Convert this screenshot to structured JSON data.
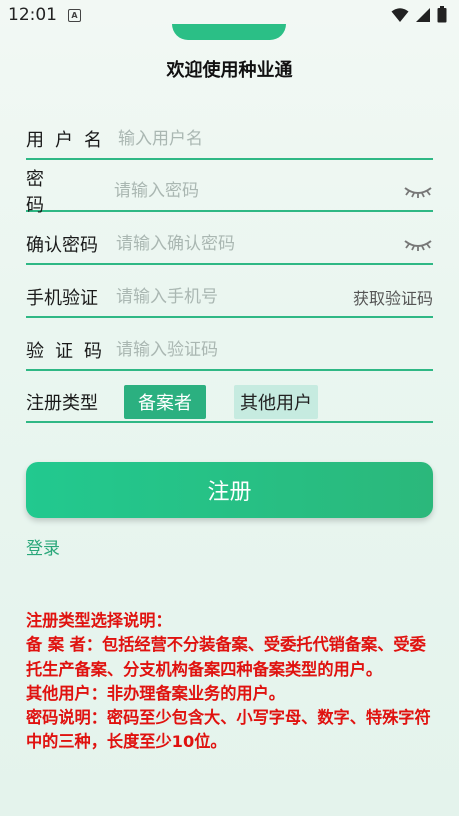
{
  "status_bar": {
    "time": "12:01",
    "notification_icon": "A"
  },
  "page_title": "欢迎使用种业通",
  "form": {
    "username": {
      "label": "用户名",
      "placeholder": "输入用户名"
    },
    "password": {
      "label": "密码",
      "placeholder": "请输入密码"
    },
    "confirm_password": {
      "label": "确认密码",
      "placeholder": "请输入确认密码"
    },
    "phone": {
      "label": "手机验证",
      "placeholder": "请输入手机号",
      "get_code_label": "获取验证码"
    },
    "code": {
      "label": "验证码",
      "placeholder": "请输入验证码"
    },
    "reg_type": {
      "label": "注册类型",
      "options": [
        "备案者",
        "其他用户"
      ],
      "selected": "备案者"
    }
  },
  "register_button": "注册",
  "login_link": "登录",
  "notes": {
    "heading": "注册类型选择说明：",
    "filer": "备 案 者：包括经营不分装备案、受委托代销备案、受委托生产备案、分支机构备案四种备案类型的用户。",
    "other": "其他用户：非办理备案业务的用户。",
    "password": "密码说明：密码至少包含大、小写字母、数字、特殊字符中的三种，长度至少10位。"
  },
  "colors": {
    "accent": "#2bb080",
    "notes_red": "#e0120f",
    "underline": "#2fb885"
  }
}
